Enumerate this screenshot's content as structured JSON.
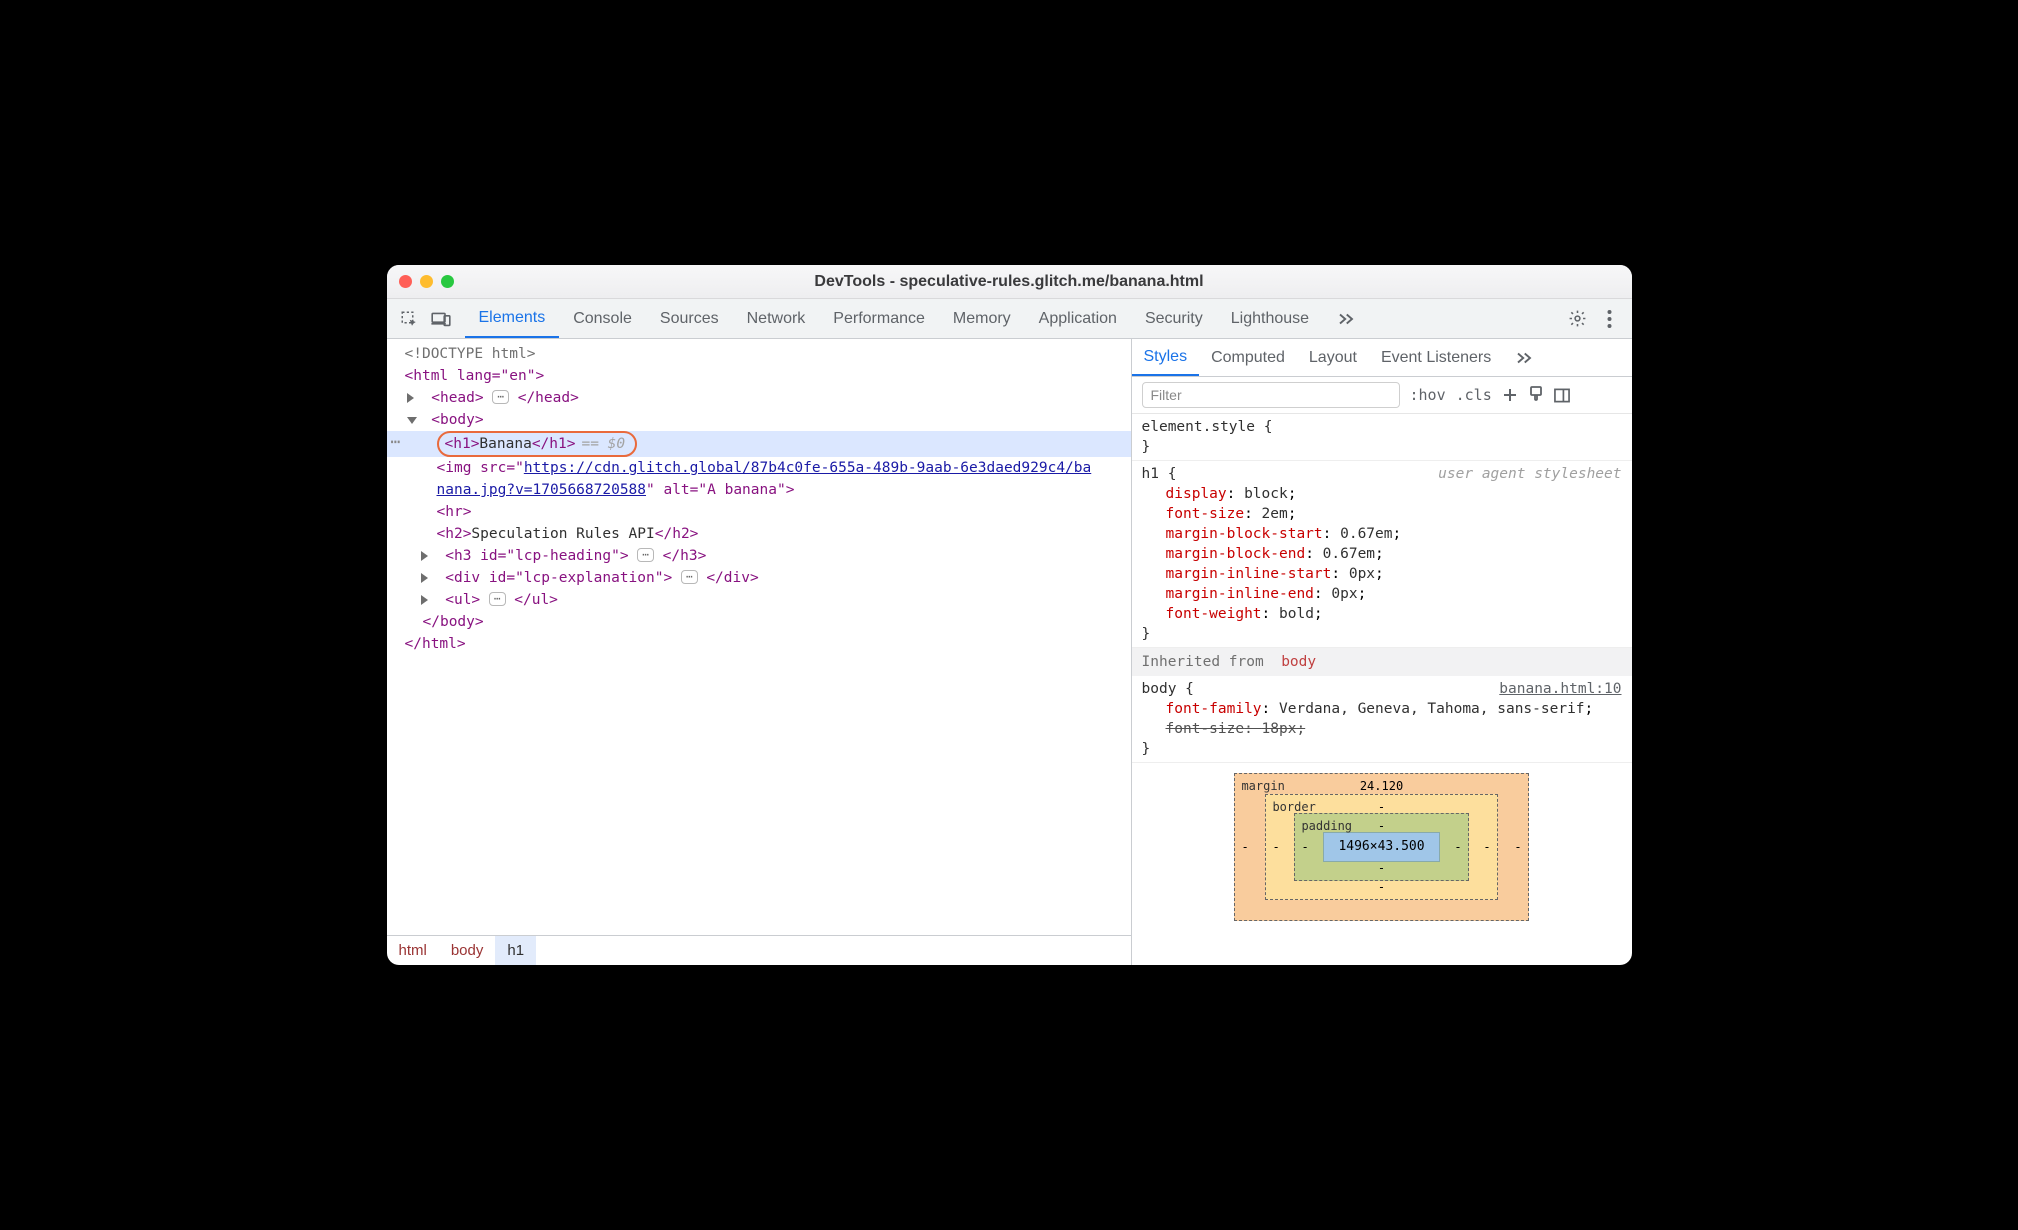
{
  "window": {
    "title": "DevTools - speculative-rules.glitch.me/banana.html"
  },
  "mainTabs": [
    "Elements",
    "Console",
    "Sources",
    "Network",
    "Performance",
    "Memory",
    "Application",
    "Security",
    "Lighthouse"
  ],
  "mainTabActive": 0,
  "sideTabs": [
    "Styles",
    "Computed",
    "Layout",
    "Event Listeners"
  ],
  "sideTabActive": 0,
  "filterPlaceholder": "Filter",
  "filterButtons": {
    "hov": ":hov",
    "cls": ".cls"
  },
  "dom": {
    "doctype": "<!DOCTYPE html>",
    "htmlOpen": "<html lang=\"en\">",
    "head": "<head>",
    "headClose": "</head>",
    "bodyOpen": "<body>",
    "selected": {
      "open": "<h1>",
      "text": "Banana",
      "close": "</h1>",
      "var": "== $0"
    },
    "imgLine1a": "<img src=\"",
    "imgUrl1": "https://cdn.glitch.global/87b4c0fe-655a-489b-9aab-6e3daed929c4/ba",
    "imgUrl2": "nana.jpg?v=1705668720588",
    "imgLine2b": "\" alt=\"A banana\">",
    "hr": "<hr>",
    "h2open": "<h2>",
    "h2text": "Speculation Rules API",
    "h2close": "</h2>",
    "h3": "<h3 id=\"lcp-heading\">",
    "h3close": "</h3>",
    "div": "<div id=\"lcp-explanation\">",
    "divclose": "</div>",
    "ul": "<ul>",
    "ulclose": "</ul>",
    "bodyClose": "</body>",
    "htmlClose": "</html>"
  },
  "breadcrumbs": [
    "html",
    "body",
    "h1"
  ],
  "styles": {
    "elementStyle": "element.style {",
    "h1rule": {
      "selector": "h1 {",
      "ua": "user agent stylesheet",
      "decls": [
        [
          "display",
          "block"
        ],
        [
          "font-size",
          "2em"
        ],
        [
          "margin-block-start",
          "0.67em"
        ],
        [
          "margin-block-end",
          "0.67em"
        ],
        [
          "margin-inline-start",
          "0px"
        ],
        [
          "margin-inline-end",
          "0px"
        ],
        [
          "font-weight",
          "bold"
        ]
      ]
    },
    "inherit": {
      "label": "Inherited from",
      "from": "body"
    },
    "bodyrule": {
      "selector": "body {",
      "src": "banana.html:10",
      "decls": [
        [
          "font-family",
          "Verdana, Geneva, Tahoma, sans-serif"
        ]
      ],
      "struck": [
        "font-size",
        "18px"
      ]
    }
  },
  "boxmodel": {
    "marginLabel": "margin",
    "marginTop": "24.120",
    "borderLabel": "border",
    "borderTop": "-",
    "paddingLabel": "padding",
    "paddingTop": "-",
    "content": "1496×43.500",
    "left": "-",
    "right": "-",
    "bottom": "-"
  }
}
